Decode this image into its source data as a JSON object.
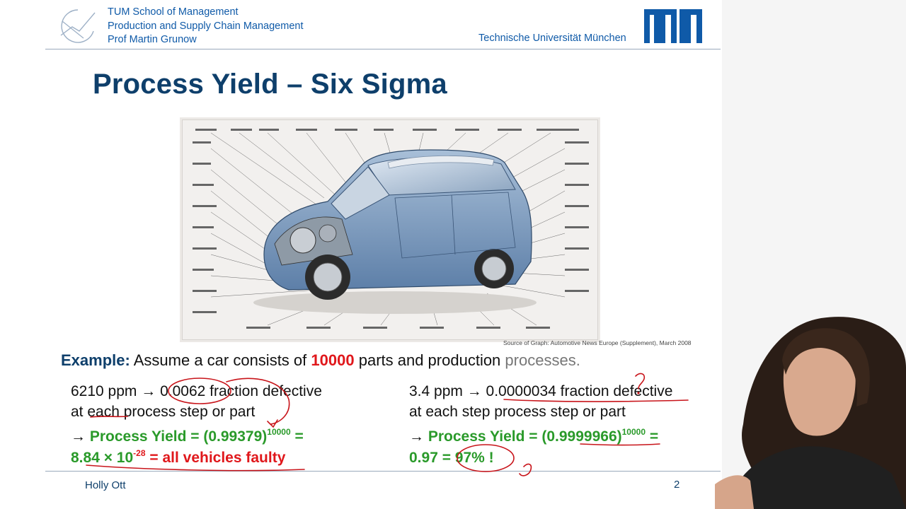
{
  "header": {
    "school": "TUM School of Management",
    "chair": "Production and Supply Chain Management",
    "professor": "Prof Martin Grunow",
    "university": "Technische Universität München"
  },
  "title": "Process Yield – Six Sigma",
  "figure": {
    "source": "Source of Graph: Automotive News Europe (Supplement), March 2008"
  },
  "example": {
    "label": "Example:",
    "pre": "Assume a car consists of",
    "count": "10000",
    "mid": "parts and production",
    "end": "processes."
  },
  "left_case": {
    "line1": "6210 ppm → 0.0062 fraction defective",
    "line2": "at each process step or part",
    "yield_prefix": "→",
    "yield_label": "Process Yield = (0.99379)",
    "yield_exp": "10000",
    "yield_eq": " =",
    "result_value": "8.84 × 10",
    "result_exp": "-28",
    "result_eq": " = ",
    "result_text": "all vehicles faulty"
  },
  "right_case": {
    "line1": "3.4 ppm → 0.0000034 fraction defective",
    "line2": "at each step process step or part",
    "yield_prefix": "→",
    "yield_label": "Process Yield = (0.9999966)",
    "yield_exp": "10000",
    "yield_eq": " =",
    "result_text": "0.97 = 97% !"
  },
  "footer": {
    "presenter": "Holly Ott",
    "page": "2"
  },
  "colors": {
    "tum_blue": "#0f5aa8",
    "title_navy": "#0e3f6b",
    "highlight_red": "#e0171b",
    "yield_green": "#2a9a2a"
  }
}
